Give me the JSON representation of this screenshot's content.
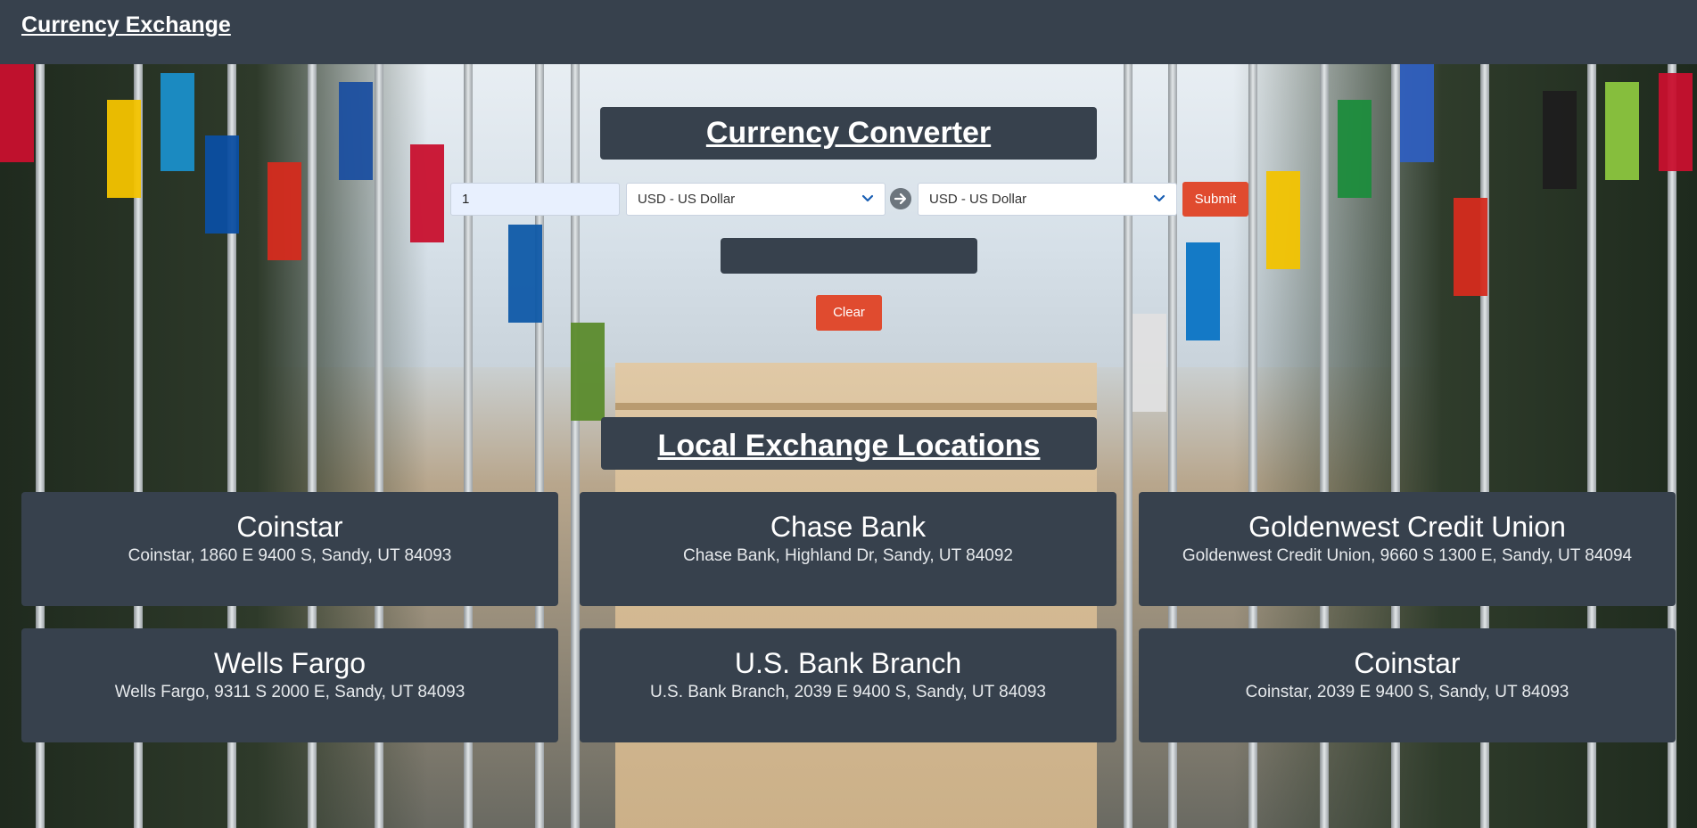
{
  "navbar": {
    "brand": "Currency Exchange"
  },
  "converter": {
    "title": "Currency Converter",
    "amount_value": "1",
    "from_currency": "USD - US Dollar",
    "to_currency": "USD - US Dollar",
    "submit_label": "Submit",
    "result_text": "",
    "clear_label": "Clear"
  },
  "locations": {
    "title": "Local Exchange Locations",
    "items": [
      {
        "name": "Coinstar",
        "address": "Coinstar, 1860 E 9400 S, Sandy, UT 84093"
      },
      {
        "name": "Chase Bank",
        "address": "Chase Bank, Highland Dr, Sandy, UT 84092"
      },
      {
        "name": "Goldenwest Credit Union",
        "address": "Goldenwest Credit Union, 9660 S 1300 E, Sandy, UT 84094"
      },
      {
        "name": "Wells Fargo",
        "address": "Wells Fargo, 9311 S 2000 E, Sandy, UT 84093"
      },
      {
        "name": "U.S. Bank Branch",
        "address": "U.S. Bank Branch, 2039 E 9400 S, Sandy, UT 84093"
      },
      {
        "name": "Coinstar",
        "address": "Coinstar, 2039 E 9400 S, Sandy, UT 84093"
      }
    ]
  },
  "icons": {
    "from_select": "chevron-down-icon",
    "to_select": "chevron-down-icon",
    "swap": "arrow-right-circle-icon"
  },
  "colors": {
    "navbar": "#37414d",
    "panel": "#37414d",
    "accent_button": "#e04b2f",
    "chevron": "#1a5fb4"
  }
}
